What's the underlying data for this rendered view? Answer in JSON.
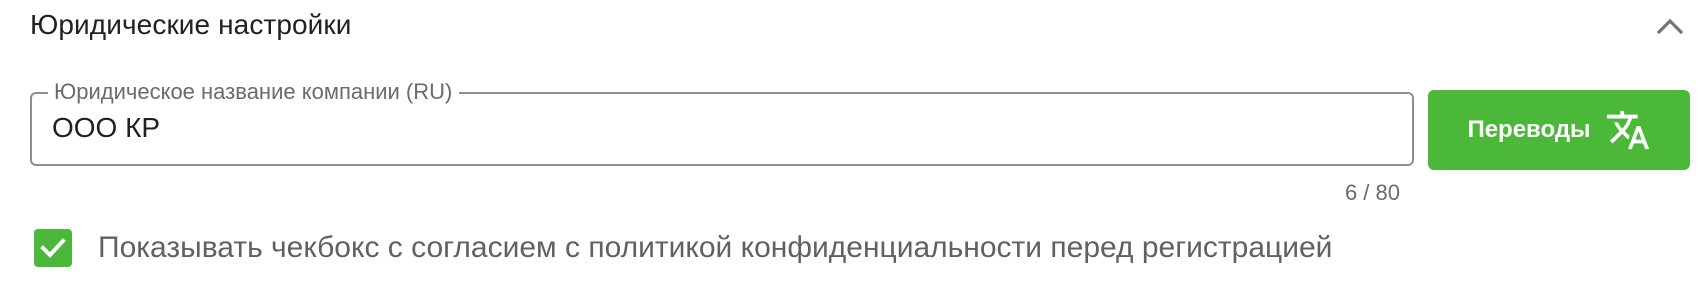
{
  "section": {
    "title": "Юридические настройки",
    "toggle_icon": "chevron-up-icon"
  },
  "legal_name_field": {
    "label": "Юридическое название компании (RU)",
    "value": "ООО КР",
    "counter": "6 / 80"
  },
  "translations_button": {
    "label": "Переводы",
    "icon": "translate-icon",
    "color": "#4cb83a"
  },
  "privacy_checkbox": {
    "checked": true,
    "label": "Показывать чекбокс с согласием с политикой конфиденциальности перед регистрацией",
    "color": "#4cb83a"
  }
}
